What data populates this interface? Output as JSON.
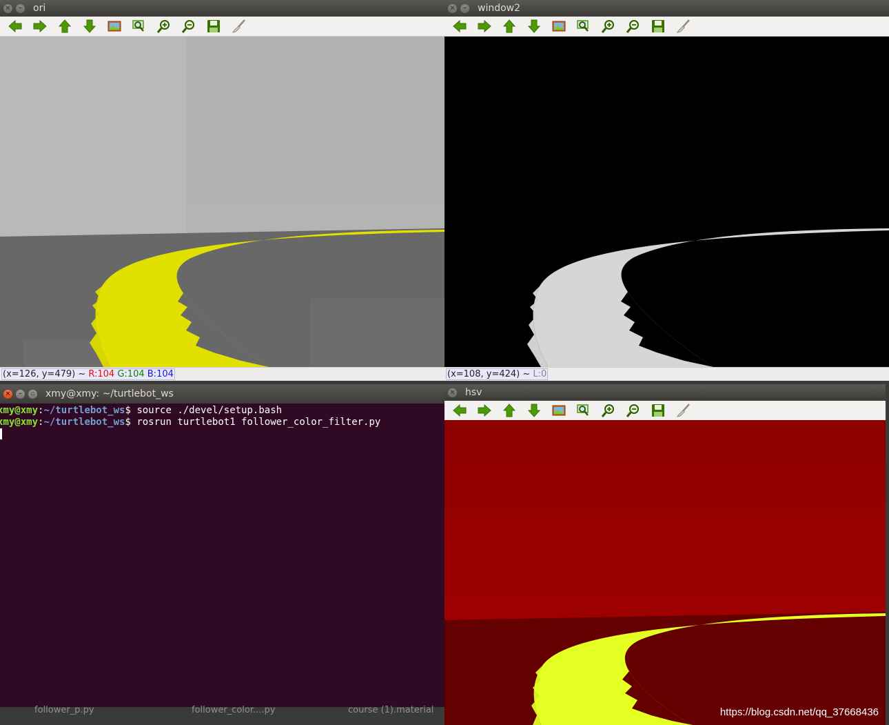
{
  "windows": {
    "ori": {
      "title": "ori",
      "status": {
        "coords": "(x=126, y=479) ~ ",
        "r": "R:104",
        "g": "G:104",
        "b": "B:104"
      }
    },
    "window2": {
      "title": "window2",
      "status": {
        "coords": "(x=108, y=424) ~ ",
        "l": "L:0"
      }
    },
    "hsv": {
      "title": "hsv"
    },
    "terminal": {
      "title": "xmy@xmy: ~/turtlebot_ws",
      "lines": [
        {
          "user": "xmy@xmy",
          "sep": ":",
          "path": "~/turtlebot_ws",
          "prompt": "$ ",
          "cmd": "source ./devel/setup.bash"
        },
        {
          "user": "xmy@xmy",
          "sep": ":",
          "path": "~/turtlebot_ws",
          "prompt": "$ ",
          "cmd": "rosrun turtlebot1 follower_color_filter.py"
        }
      ]
    }
  },
  "toolbar_icons": [
    "arrow-left-icon",
    "arrow-right-icon",
    "arrow-up-icon",
    "arrow-down-icon",
    "image-icon",
    "zoom-fit-icon",
    "zoom-in-icon",
    "zoom-out-icon",
    "save-icon",
    "brush-icon"
  ],
  "gedit_tabs": [
    "follower_p.py",
    "follower_color....py",
    "course (1).material"
  ],
  "watermark": "https://blog.csdn.net/qq_37668436",
  "colors": {
    "arrow_green": "#4e9a06",
    "terminal_bg": "#300a24",
    "road_yellow": "#e6e600",
    "hsv_yellow": "#e8ff20"
  }
}
